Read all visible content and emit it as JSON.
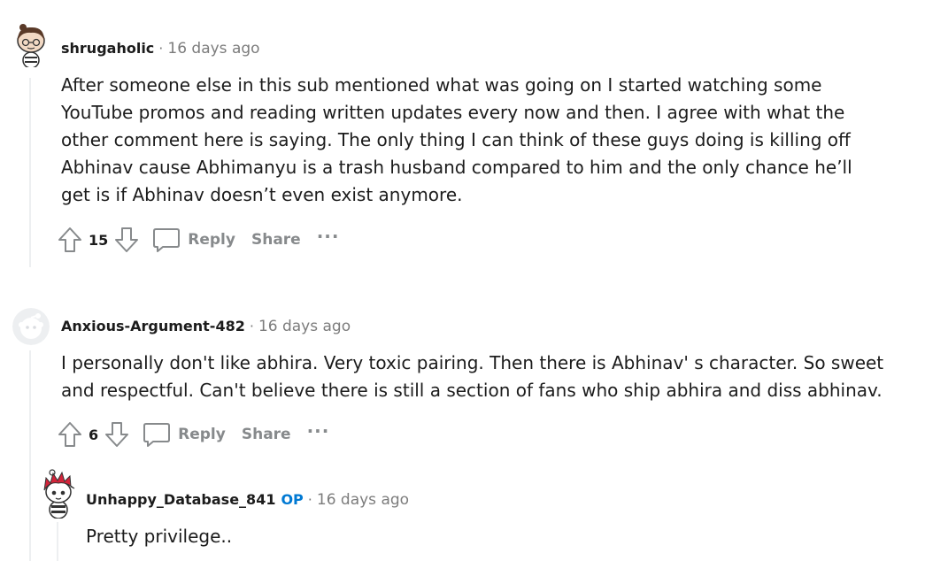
{
  "comments": [
    {
      "author": "shrugaholic",
      "separator": "·",
      "time": "16 days ago",
      "op_badge": "",
      "body": "After someone else in this sub mentioned what was going on I started watching some YouTube promos and reading written updates every now and then. I agree with what the other comment here is saying. The only thing I can think of these guys doing is killing off Abhinav cause Abhimanyu is a trash husband compared to him and the only chance he’ll get is if Abhinav doesn’t even exist anymore.",
      "votes": "15",
      "reply_label": "Reply",
      "share_label": "Share",
      "more_label": "···"
    },
    {
      "author": "Anxious-Argument-482",
      "separator": "·",
      "time": "16 days ago",
      "op_badge": "",
      "body": "I personally don't like abhira. Very toxic pairing. Then there is Abhinav' s character. So sweet and respectful. Can't believe there is still a section of fans who ship abhira and diss abhinav.",
      "votes": "6",
      "reply_label": "Reply",
      "share_label": "Share",
      "more_label": "···"
    },
    {
      "author": "Unhappy_Database_841",
      "separator": "·",
      "time": "16 days ago",
      "op_badge": "OP",
      "body": "Pretty privilege.."
    }
  ],
  "icons": {
    "upvote": "upvote-icon",
    "downvote": "downvote-icon",
    "reply": "comment-bubble-icon",
    "more": "more-options-icon"
  },
  "colors": {
    "op": "#0079d3",
    "muted": "#878a8c",
    "thread_line": "#edeff1"
  }
}
